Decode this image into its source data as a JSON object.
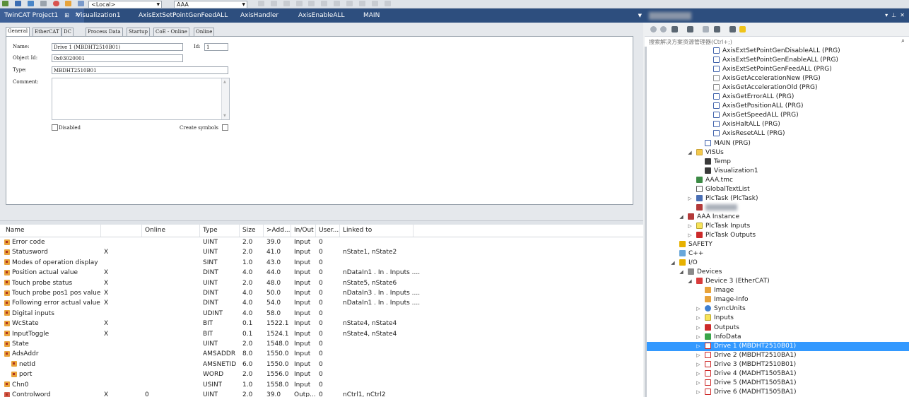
{
  "toolbar": {
    "target_select": "<Local>",
    "project_select": "AAA"
  },
  "doc_tabs": [
    "TwinCAT Project1",
    "Visualization1",
    "AxisExtSetPointGenFeedALL",
    "AxisHandler",
    "AxisEnableALL",
    "MAIN"
  ],
  "sub_tabs": [
    "General",
    "EtherCAT",
    "DC",
    "Process Data",
    "Startup",
    "CoE - Online",
    "Online"
  ],
  "general": {
    "name_label": "Name:",
    "name_value": "Drive 1 (MBDHT2510B01)",
    "id_label": "Id:",
    "id_value": "1",
    "objid_label": "Object Id:",
    "objid_value": "0x03020001",
    "type_label": "Type:",
    "type_value": "MBDHT2510B01",
    "comment_label": "Comment:",
    "disabled_label": "Disabled",
    "create_symbols_label": "Create symbols"
  },
  "grid": {
    "columns": [
      "Name",
      "",
      "Online",
      "Type",
      "Size",
      ">Add...",
      "In/Out",
      "User...",
      "Linked to"
    ],
    "rows": [
      {
        "name": "Error code",
        "x": "",
        "online": "",
        "type": "UINT",
        "size": "2.0",
        "addr": "39.0",
        "io": "Input",
        "user": "0",
        "linked": "",
        "indent": 0,
        "kind": "in"
      },
      {
        "name": "Statusword",
        "x": "X",
        "online": "",
        "type": "UINT",
        "size": "2.0",
        "addr": "41.0",
        "io": "Input",
        "user": "0",
        "linked": "nState1, nState2",
        "indent": 0,
        "kind": "in"
      },
      {
        "name": "Modes of operation display",
        "x": "",
        "online": "",
        "type": "SINT",
        "size": "1.0",
        "addr": "43.0",
        "io": "Input",
        "user": "0",
        "linked": "",
        "indent": 0,
        "kind": "in"
      },
      {
        "name": "Position actual value",
        "x": "X",
        "online": "",
        "type": "DINT",
        "size": "4.0",
        "addr": "44.0",
        "io": "Input",
        "user": "0",
        "linked": "nDataIn1 . In . Inputs ....",
        "indent": 0,
        "kind": "in"
      },
      {
        "name": "Touch probe status",
        "x": "X",
        "online": "",
        "type": "UINT",
        "size": "2.0",
        "addr": "48.0",
        "io": "Input",
        "user": "0",
        "linked": "nState5, nState6",
        "indent": 0,
        "kind": "in"
      },
      {
        "name": "Touch probe pos1 pos value",
        "x": "X",
        "online": "",
        "type": "DINT",
        "size": "4.0",
        "addr": "50.0",
        "io": "Input",
        "user": "0",
        "linked": "nDataIn3 . In . Inputs ....",
        "indent": 0,
        "kind": "in"
      },
      {
        "name": "Following error actual value",
        "x": "X",
        "online": "",
        "type": "DINT",
        "size": "4.0",
        "addr": "54.0",
        "io": "Input",
        "user": "0",
        "linked": "nDataIn1 . In . Inputs ....",
        "indent": 0,
        "kind": "in"
      },
      {
        "name": "Digital inputs",
        "x": "",
        "online": "",
        "type": "UDINT",
        "size": "4.0",
        "addr": "58.0",
        "io": "Input",
        "user": "0",
        "linked": "",
        "indent": 0,
        "kind": "in"
      },
      {
        "name": "WcState",
        "x": "X",
        "online": "",
        "type": "BIT",
        "size": "0.1",
        "addr": "1522.1",
        "io": "Input",
        "user": "0",
        "linked": "nState4, nState4",
        "indent": 0,
        "kind": "in"
      },
      {
        "name": "InputToggle",
        "x": "X",
        "online": "",
        "type": "BIT",
        "size": "0.1",
        "addr": "1524.1",
        "io": "Input",
        "user": "0",
        "linked": "nState4, nState4",
        "indent": 0,
        "kind": "in"
      },
      {
        "name": "State",
        "x": "",
        "online": "",
        "type": "UINT",
        "size": "2.0",
        "addr": "1548.0",
        "io": "Input",
        "user": "0",
        "linked": "",
        "indent": 0,
        "kind": "in"
      },
      {
        "name": "AdsAddr",
        "x": "",
        "online": "",
        "type": "AMSADDR",
        "size": "8.0",
        "addr": "1550.0",
        "io": "Input",
        "user": "0",
        "linked": "",
        "indent": 0,
        "kind": "in"
      },
      {
        "name": "netId",
        "x": "",
        "online": "",
        "type": "AMSNETID",
        "size": "6.0",
        "addr": "1550.0",
        "io": "Input",
        "user": "0",
        "linked": "",
        "indent": 1,
        "kind": "in"
      },
      {
        "name": "port",
        "x": "",
        "online": "",
        "type": "WORD",
        "size": "2.0",
        "addr": "1556.0",
        "io": "Input",
        "user": "0",
        "linked": "",
        "indent": 1,
        "kind": "in"
      },
      {
        "name": "Chn0",
        "x": "",
        "online": "",
        "type": "USINT",
        "size": "1.0",
        "addr": "1558.0",
        "io": "Input",
        "user": "0",
        "linked": "",
        "indent": 0,
        "kind": "in"
      },
      {
        "name": "Controlword",
        "x": "X",
        "online": "0",
        "type": "UINT",
        "size": "2.0",
        "addr": "39.0",
        "io": "Outp...",
        "user": "0",
        "linked": "nCtrl1, nCtrl2",
        "indent": 0,
        "kind": "out"
      }
    ]
  },
  "solution": {
    "search_placeholder": "搜索解决方案资源管理器(Ctrl+;)",
    "tree": [
      {
        "label": "AxisExtSetPointGenDisableALL (PRG)",
        "level": 6,
        "icon": "prg",
        "tw": ""
      },
      {
        "label": "AxisExtSetPointGenEnableALL (PRG)",
        "level": 6,
        "icon": "prg",
        "tw": ""
      },
      {
        "label": "AxisExtSetPointGenFeedALL (PRG)",
        "level": 6,
        "icon": "prg",
        "tw": ""
      },
      {
        "label": "AxisGetAccelerationNew (PRG)",
        "level": 6,
        "icon": "prg2",
        "tw": ""
      },
      {
        "label": "AxisGetAccelerationOld (PRG)",
        "level": 6,
        "icon": "prg2",
        "tw": ""
      },
      {
        "label": "AxisGetErrorALL (PRG)",
        "level": 6,
        "icon": "prg",
        "tw": ""
      },
      {
        "label": "AxisGetPositionALL (PRG)",
        "level": 6,
        "icon": "prg",
        "tw": ""
      },
      {
        "label": "AxisGetSpeedALL (PRG)",
        "level": 6,
        "icon": "prg",
        "tw": ""
      },
      {
        "label": "AxisHaltALL (PRG)",
        "level": 6,
        "icon": "prg",
        "tw": ""
      },
      {
        "label": "AxisResetALL (PRG)",
        "level": 6,
        "icon": "prg",
        "tw": ""
      },
      {
        "label": "MAIN (PRG)",
        "level": 5,
        "icon": "prg",
        "tw": ""
      },
      {
        "label": "VISUs",
        "level": 4,
        "icon": "folder",
        "tw": "expanded"
      },
      {
        "label": "Temp",
        "level": 5,
        "icon": "visu",
        "tw": ""
      },
      {
        "label": "Visualization1",
        "level": 5,
        "icon": "visu",
        "tw": ""
      },
      {
        "label": "AAA.tmc",
        "level": 4,
        "icon": "tmc",
        "tw": ""
      },
      {
        "label": "GlobalTextList",
        "level": 4,
        "icon": "list",
        "tw": ""
      },
      {
        "label": "PlcTask (PlcTask)",
        "level": 4,
        "icon": "task",
        "tw": "collapsed"
      },
      {
        "label": "",
        "level": 4,
        "icon": "inst",
        "tw": "",
        "blur": true
      },
      {
        "label": "AAA Instance",
        "level": 3,
        "icon": "inst",
        "tw": "expanded"
      },
      {
        "label": "PlcTask Inputs",
        "level": 4,
        "icon": "in",
        "tw": "collapsed"
      },
      {
        "label": "PlcTask Outputs",
        "level": 4,
        "icon": "out",
        "tw": "collapsed"
      },
      {
        "label": "SAFETY",
        "level": 2,
        "icon": "safety",
        "tw": ""
      },
      {
        "label": "C++",
        "level": 2,
        "icon": "cpp",
        "tw": ""
      },
      {
        "label": "I/O",
        "level": 2,
        "icon": "io",
        "tw": "expanded"
      },
      {
        "label": "Devices",
        "level": 3,
        "icon": "dev",
        "tw": "expanded"
      },
      {
        "label": "Device 3 (EtherCAT)",
        "level": 4,
        "icon": "ecat",
        "tw": "expanded"
      },
      {
        "label": "Image",
        "level": 5,
        "icon": "img",
        "tw": ""
      },
      {
        "label": "Image-Info",
        "level": 5,
        "icon": "img",
        "tw": ""
      },
      {
        "label": "SyncUnits",
        "level": 5,
        "icon": "sync",
        "tw": "collapsed"
      },
      {
        "label": "Inputs",
        "level": 5,
        "icon": "in",
        "tw": "collapsed"
      },
      {
        "label": "Outputs",
        "level": 5,
        "icon": "out",
        "tw": "collapsed"
      },
      {
        "label": "InfoData",
        "level": 5,
        "icon": "info",
        "tw": "collapsed"
      },
      {
        "label": "Drive 1 (MBDHT2510B01)",
        "level": 5,
        "icon": "drive",
        "tw": "collapsed",
        "selected": true
      },
      {
        "label": "Drive 2 (MBDHT2510BA1)",
        "level": 5,
        "icon": "drive",
        "tw": "collapsed"
      },
      {
        "label": "Drive 3 (MBDHT2510B01)",
        "level": 5,
        "icon": "drive",
        "tw": "collapsed"
      },
      {
        "label": "Drive 4 (MADHT1505BA1)",
        "level": 5,
        "icon": "drive",
        "tw": "collapsed"
      },
      {
        "label": "Drive 5 (MADHT1505BA1)",
        "level": 5,
        "icon": "drive",
        "tw": "collapsed"
      },
      {
        "label": "Drive 6 (MADHT1505BA1)",
        "level": 5,
        "icon": "drive",
        "tw": "collapsed"
      }
    ]
  }
}
